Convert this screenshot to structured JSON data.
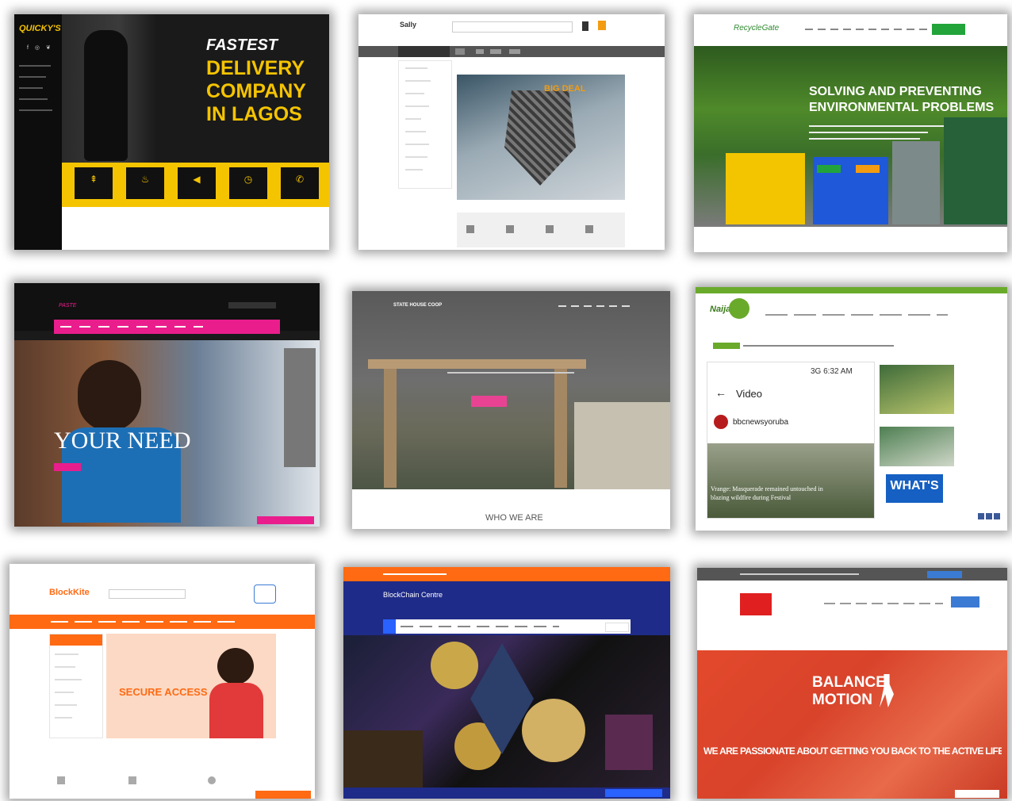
{
  "t1": {
    "logo": "QUICKY'S",
    "headline": [
      "FASTEST",
      "DELIVERY",
      "COMPANY",
      "IN LAGOS"
    ],
    "colors": {
      "accent": "#f5c400",
      "dark": "#111111"
    },
    "icons": [
      "signpost-icon",
      "fire-icon",
      "megaphone-icon",
      "clock-icon",
      "phone-icon"
    ]
  },
  "t2": {
    "logo": "Sally",
    "banner_text": "BIG DEAL",
    "colors": {
      "accent": "#f39c12",
      "nav": "#555555"
    }
  },
  "t3": {
    "logo": "RecycleGate",
    "headline": [
      "SOLVING AND PREVENTING",
      "ENVIRONMENTAL PROBLEMS"
    ],
    "colors": {
      "accent": "#22a43a",
      "button": "#f39c12"
    }
  },
  "t4": {
    "logo": "PASTE",
    "headline": "YOUR NEED",
    "colors": {
      "accent": "#e91e8c"
    }
  },
  "t5": {
    "logo": "STATE HOUSE COOP",
    "section_title": "WHO WE ARE",
    "colors": {
      "accent": "#e84393"
    }
  },
  "t6": {
    "logo": "Naija",
    "video_label": "Video",
    "channel": "bbcnewsyoruba",
    "status_time": "3G 6:32 AM",
    "caption": "Vrange: Masquerade remained untouched in blazing wildfire during Festival",
    "whats_text": "WHAT'S",
    "colors": {
      "accent": "#6aaa2a"
    }
  },
  "t7": {
    "logo": "BlockKite",
    "banner": [
      "SECURE ACCESS"
    ],
    "colors": {
      "accent": "#ff6a13",
      "banner_bg": "#fbd9c4"
    }
  },
  "t8": {
    "logo": "BlockChain Centre",
    "colors": {
      "accent": "#ff6a13",
      "nav": "#1f2b88"
    }
  },
  "t9": {
    "logo": "BALANCE MOTION",
    "headline": [
      "BALANCE",
      "MOTION"
    ],
    "tagline": "WE ARE PASSIONATE ABOUT GETTING YOU BACK TO THE ACTIVE LIFESTYLE YOU LOVE",
    "colors": {
      "accent": "#e3492c"
    }
  }
}
